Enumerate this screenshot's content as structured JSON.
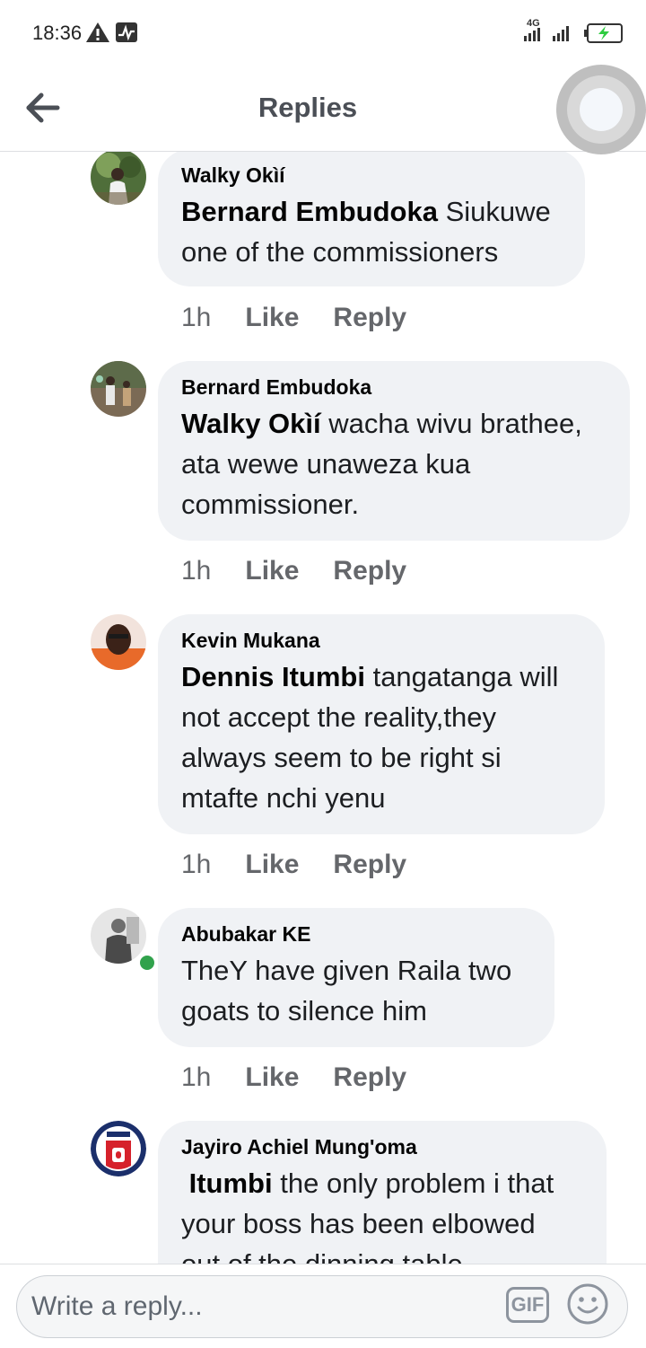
{
  "status_bar": {
    "time": "18:36",
    "network": "4G",
    "icons": [
      "warning-icon",
      "activity-icon",
      "signal-icon",
      "signal-icon",
      "battery-charging-icon"
    ]
  },
  "header": {
    "title": "Replies",
    "back_icon": "back-arrow-icon"
  },
  "comments": [
    {
      "author": "Walky Okìí",
      "mention": "Bernard Embudoka",
      "text_lines": [
        "Siukuwe",
        "one of the commissioners"
      ],
      "time": "1h",
      "like": "Like",
      "reply": "Reply"
    },
    {
      "author": "Bernard Embudoka",
      "mention": "Walky Okìí",
      "text_lines": [
        "wacha wivu brathee,",
        "ata wewe unaweza kua",
        "commissioner."
      ],
      "time": "1h",
      "like": "Like",
      "reply": "Reply"
    },
    {
      "author": "Kevin Mukana",
      "mention": "Dennis Itumbi",
      "text_lines": [
        "tangatanga will",
        "not accept the reality,they",
        "always seem to be right si",
        "mtafte nchi yenu"
      ],
      "time": "1h",
      "like": "Like",
      "reply": "Reply"
    },
    {
      "author": "Abubakar KE",
      "mention": "",
      "text_lines": [
        "TheY have given Raila two",
        "goats to silence him"
      ],
      "time": "1h",
      "like": "Like",
      "reply": "Reply",
      "online": true
    },
    {
      "author": "Jayiro Achiel Mung'oma",
      "mention": "Itumbi",
      "text_lines": [
        "the only problem i that",
        "your boss has been elbowed",
        "out of the dinning table"
      ]
    }
  ],
  "composer": {
    "placeholder": "Write a reply...",
    "gif_label": "GIF",
    "emoji_icon": "smiley-icon"
  },
  "colors": {
    "bubble": "#f0f2f5",
    "meta_text": "#65676b",
    "online": "#31a24c",
    "charging": "#2ecc40"
  }
}
